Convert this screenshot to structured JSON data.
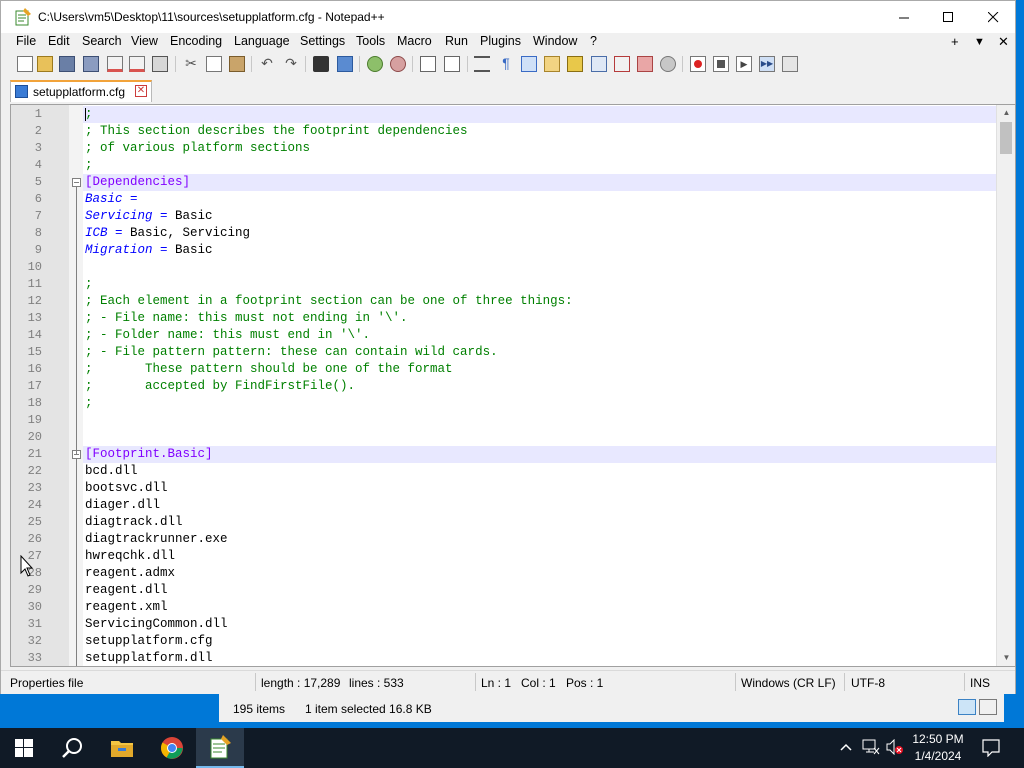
{
  "window": {
    "title": "C:\\Users\\vm5\\Desktop\\11\\sources\\setupplatform.cfg - Notepad++",
    "minimize_icon": "minimize-icon",
    "maximize_icon": "maximize-icon",
    "close_icon": "close-icon"
  },
  "menu": {
    "items": [
      "File",
      "Edit",
      "Search",
      "View",
      "Encoding",
      "Language",
      "Settings",
      "Tools",
      "Macro",
      "Run",
      "Plugins",
      "Window",
      "?"
    ],
    "right": [
      "+",
      "▼",
      "✕"
    ]
  },
  "toolbar": {
    "icons": [
      "new-file-icon",
      "open-file-icon",
      "save-icon",
      "save-all-icon",
      "close-icon",
      "close-all-icon",
      "print-icon",
      "cut-icon",
      "copy-icon",
      "paste-icon",
      "undo-icon",
      "redo-icon",
      "find-icon",
      "replace-icon",
      "zoom-in-icon",
      "zoom-out-icon",
      "sync-vertical-icon",
      "sync-horizontal-icon",
      "word-wrap-icon",
      "show-all-chars-icon",
      "indent-guide-icon",
      "udl-icon",
      "doc-map-icon",
      "function-list-icon",
      "folder-workspace-icon",
      "monitoring-icon",
      "record-macro-icon",
      "stop-record-icon",
      "play-macro-icon",
      "run-macro-multiple-icon",
      "save-macro-icon"
    ]
  },
  "tab": {
    "label": "setupplatform.cfg"
  },
  "editor": {
    "lines": [
      {
        "n": "1",
        "t": "comment",
        "text": ";"
      },
      {
        "n": "2",
        "t": "comment",
        "text": "; This section describes the footprint dependencies"
      },
      {
        "n": "3",
        "t": "comment",
        "text": "; of various platform sections"
      },
      {
        "n": "4",
        "t": "comment",
        "text": ";"
      },
      {
        "n": "5",
        "t": "section",
        "text": "[Dependencies]"
      },
      {
        "n": "6",
        "t": "kv",
        "key": "Basic",
        "eq": " =",
        "val": ""
      },
      {
        "n": "7",
        "t": "kv",
        "key": "Servicing",
        "eq": " = ",
        "val": "Basic"
      },
      {
        "n": "8",
        "t": "kv",
        "key": "ICB",
        "eq": " = ",
        "val": "Basic, Servicing"
      },
      {
        "n": "9",
        "t": "kv",
        "key": "Migration",
        "eq": " = ",
        "val": "Basic"
      },
      {
        "n": "10",
        "t": "plain",
        "text": ""
      },
      {
        "n": "11",
        "t": "comment",
        "text": ";"
      },
      {
        "n": "12",
        "t": "comment",
        "text": "; Each element in a footprint section can be one of three things:"
      },
      {
        "n": "13",
        "t": "comment",
        "text": "; - File name: this must not ending in '\\'."
      },
      {
        "n": "14",
        "t": "comment",
        "text": "; - Folder name: this must end in '\\'."
      },
      {
        "n": "15",
        "t": "comment",
        "text": "; - File pattern pattern: these can contain wild cards."
      },
      {
        "n": "16",
        "t": "comment",
        "text": ";       These pattern should be one of the format"
      },
      {
        "n": "17",
        "t": "comment",
        "text": ";       accepted by FindFirstFile()."
      },
      {
        "n": "18",
        "t": "comment",
        "text": ";"
      },
      {
        "n": "19",
        "t": "plain",
        "text": ""
      },
      {
        "n": "20",
        "t": "plain",
        "text": ""
      },
      {
        "n": "21",
        "t": "section",
        "text": "[Footprint.Basic]"
      },
      {
        "n": "22",
        "t": "plain",
        "text": "bcd.dll"
      },
      {
        "n": "23",
        "t": "plain",
        "text": "bootsvc.dll"
      },
      {
        "n": "24",
        "t": "plain",
        "text": "diager.dll"
      },
      {
        "n": "25",
        "t": "plain",
        "text": "diagtrack.dll"
      },
      {
        "n": "26",
        "t": "plain",
        "text": "diagtrackrunner.exe"
      },
      {
        "n": "27",
        "t": "plain",
        "text": "hwreqchk.dll"
      },
      {
        "n": "28",
        "t": "plain",
        "text": "reagent.admx"
      },
      {
        "n": "29",
        "t": "plain",
        "text": "reagent.dll"
      },
      {
        "n": "30",
        "t": "plain",
        "text": "reagent.xml"
      },
      {
        "n": "31",
        "t": "plain",
        "text": "ServicingCommon.dll"
      },
      {
        "n": "32",
        "t": "plain",
        "text": "setupplatform.cfg"
      },
      {
        "n": "33",
        "t": "plain",
        "text": "setupplatform.dll"
      }
    ]
  },
  "status": {
    "file_type": "Properties file",
    "length": "length : 17,289",
    "lines": "lines : 533",
    "ln": "Ln : 1",
    "col": "Col : 1",
    "pos": "Pos : 1",
    "eol": "Windows (CR LF)",
    "encoding": "UTF-8",
    "mode": "INS"
  },
  "explorer": {
    "items": "195 items",
    "selected": "1 item selected  16.8 KB"
  },
  "taskbar": {
    "icons": [
      "windows-start-icon",
      "search-icon",
      "file-explorer-icon",
      "chrome-icon",
      "notepad-plus-plus-icon"
    ],
    "tray_icons": [
      "chevron-up-icon",
      "network-icon",
      "volume-muted-icon",
      "notification-icon"
    ],
    "time": "12:50 PM",
    "date": "1/4/2024"
  },
  "colors": {
    "comment": "#008000",
    "section": "#8000ff",
    "key": "#0000ff",
    "current_line": "#e8e8ff",
    "desktop": "#0078d7",
    "taskbar": "#101a26"
  }
}
